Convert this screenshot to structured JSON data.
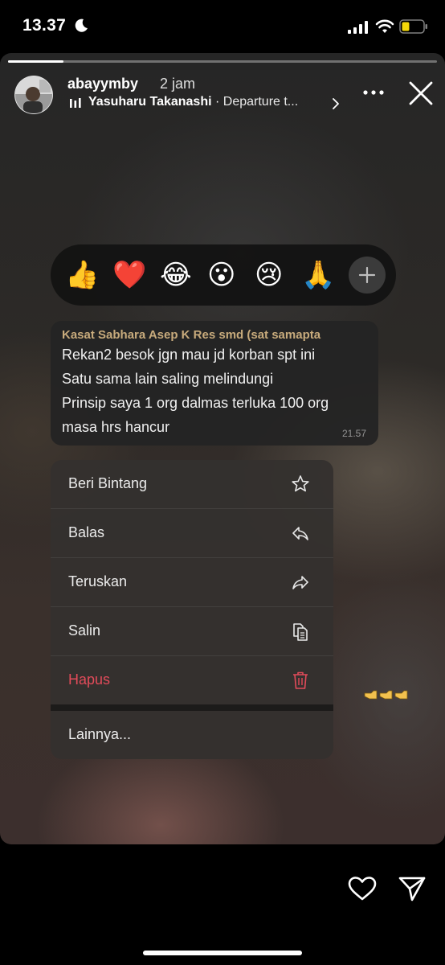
{
  "status_bar": {
    "time": "13.37"
  },
  "story": {
    "progress": 0.13,
    "username": "abayymby",
    "posted": "2 jam",
    "music_artist": "Yasuharu Takanashi",
    "music_separator": " · ",
    "music_song": "Departure t..."
  },
  "reactions": [
    "👍",
    "❤️",
    "😂",
    "😮",
    "😢",
    "🙏"
  ],
  "message": {
    "sender": "Kasat Sabhara Asep K Res smd (sat samapta",
    "lines": [
      "Rekan2 besok jgn mau jd korban spt ini",
      "Satu sama lain saling melindungi",
      "Prinsip saya 1 org dalmas  terluka 100 org",
      "masa hrs hancur"
    ],
    "time": "21.57"
  },
  "menu": {
    "star": "Beri Bintang",
    "reply": "Balas",
    "forward": "Teruskan",
    "copy": "Salin",
    "delete": "Hapus",
    "more": "Lainnya..."
  },
  "colors": {
    "danger": "#e24b5a",
    "sender": "#c8ab7c"
  }
}
